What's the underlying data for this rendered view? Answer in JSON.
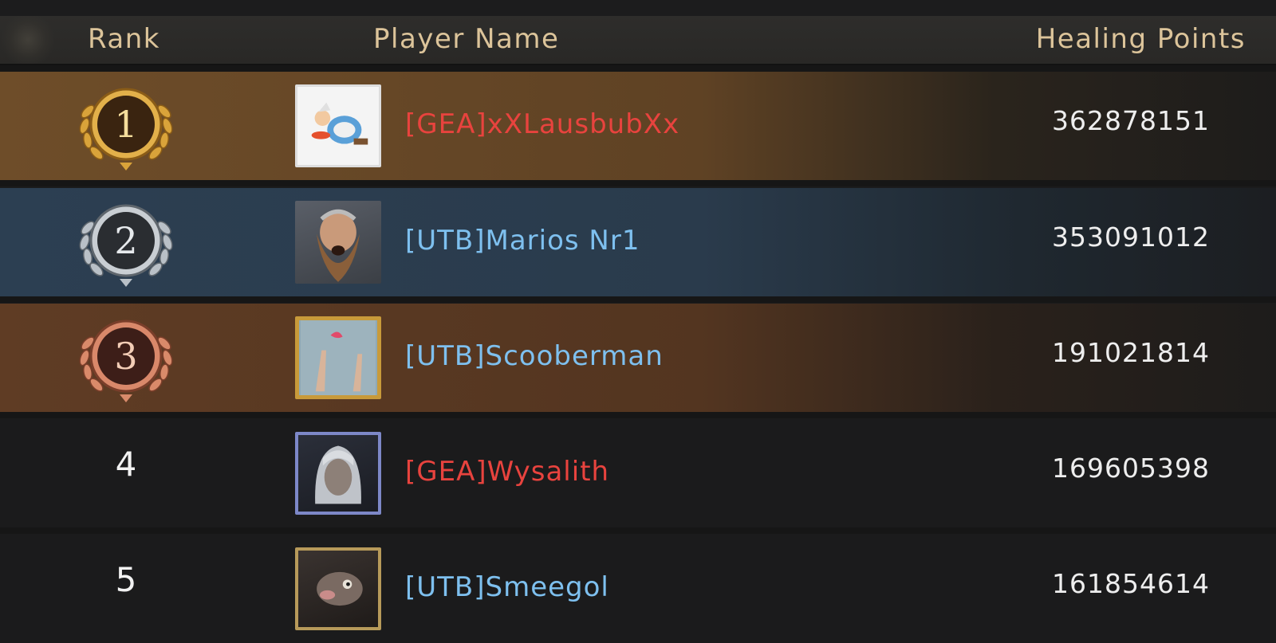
{
  "header": {
    "rank_label": "Rank",
    "player_label": "Player Name",
    "points_label": "Healing Points"
  },
  "rows": [
    {
      "rank": "1",
      "name": "[GEA]xXLausbubXx",
      "points": "362878151",
      "guild_color": "#e8433e",
      "avatar": "asterix-character-avatar"
    },
    {
      "rank": "2",
      "name": "[UTB]Marios Nr1",
      "points": "353091012",
      "guild_color": "#7ec0ef",
      "avatar": "bearded-warrior-avatar"
    },
    {
      "rank": "3",
      "name": "[UTB]Scooberman",
      "points": "191021814",
      "guild_color": "#7ec0ef",
      "avatar": "hands-up-avatar"
    },
    {
      "rank": "4",
      "name": "[GEA]Wysalith",
      "points": "169605398",
      "guild_color": "#e8433e",
      "avatar": "white-haired-elf-avatar"
    },
    {
      "rank": "5",
      "name": "[UTB]Smeegol",
      "points": "161854614",
      "guild_color": "#7ec0ef",
      "avatar": "creature-avatar"
    }
  ],
  "colors": {
    "gold_row": "#6e4d29",
    "silver_row": "#2c3f52",
    "bronze_row": "#5f3c24",
    "header_text": "#dcc49a"
  }
}
